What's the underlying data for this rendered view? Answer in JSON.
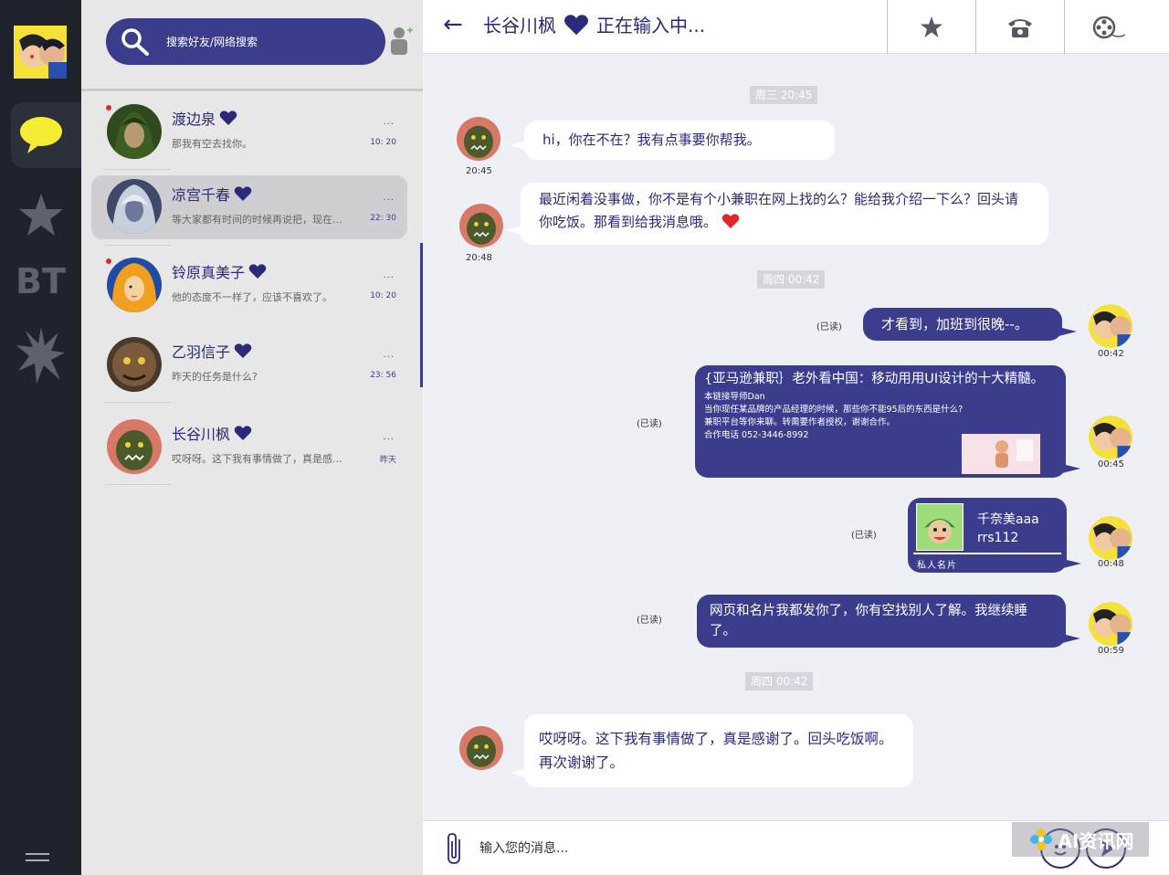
{
  "colors": {
    "accent": "#3b3d8c",
    "rail": "#1f232c",
    "panel": "#e8e7e7",
    "chat_bg": "#eef0f5",
    "unread": "#e22727",
    "heart_red": "#e02828"
  },
  "rail": {
    "items": [
      "chat-icon",
      "star-icon",
      "bt-icon",
      "burst-icon",
      "menu-icon"
    ],
    "bt_label": "BT"
  },
  "search": {
    "placeholder": "搜索好友/网络搜索"
  },
  "contacts": [
    {
      "name": "渡边泉",
      "preview": "那我有空去找你。",
      "time": "10: 20",
      "more": "···",
      "unread": true
    },
    {
      "name": "凉宫千春",
      "preview": "等大家都有时间的时候再说把，现在...",
      "time": "22: 30",
      "more": "···",
      "unread": false,
      "selected": true
    },
    {
      "name": "铃原真美子",
      "preview": "他的态度不一样了，应该不喜欢了。",
      "time": "10: 20",
      "more": "···",
      "unread": true
    },
    {
      "name": "乙羽信子",
      "preview": "昨天的任务是什么?",
      "time": "23: 56",
      "more": "···",
      "unread": false
    },
    {
      "name": "长谷川枫",
      "preview": "哎呀呀。这下我有事情做了，真是感...",
      "time": "昨天",
      "more": "···",
      "unread": false
    }
  ],
  "chat": {
    "back": "←",
    "name": "长谷川枫",
    "status": "正在输入中...",
    "stamps": [
      "周三 20:45",
      "周四 00:42",
      "周四 00:42"
    ],
    "messages": [
      {
        "from": "them",
        "text": "hi，你在不在？我有点事要你帮我。",
        "time": "20:45"
      },
      {
        "from": "them",
        "text": "最近闲着没事做，你不是有个小兼职在网上找的么？能给我介绍一下么？回头请你吃饭。那看到给我消息哦。",
        "time": "20:48"
      },
      {
        "from": "me",
        "text": "才看到，加班到很晚--。",
        "time": "00:42",
        "read": "(已读)"
      },
      {
        "from": "me",
        "type": "link",
        "title": "{亚马逊兼职｝老外看中国：移动用用UI设计的十大精髓。",
        "lines": [
          "本链接导师Dan",
          "当你现任某品牌的产品经理的时候，那些你不能95后的东西是什么?",
          "兼职平台等你来聊。转需要作者授权，谢谢合作。",
          "合作电话 052-3446-8992"
        ],
        "time": "00:45",
        "read": "(已读)"
      },
      {
        "from": "me",
        "type": "card",
        "card_name": "千奈美aaa",
        "card_id": "rrs112",
        "card_label": "私人名片",
        "time": "00:48",
        "read": "(已读)"
      },
      {
        "from": "me",
        "text": "网页和名片我都发你了，你有空找别人了解。我继续睡了。",
        "time": "00:59",
        "read": "(已读)"
      },
      {
        "from": "them",
        "text": "哎呀呀。这下我有事情做了，真是感谢了。回头吃饭啊。再次谢谢了。",
        "time": ""
      }
    ]
  },
  "header_buttons": [
    "star-icon",
    "phone-icon",
    "film-reel-icon"
  ],
  "composer": {
    "placeholder": "输入您的消息..."
  },
  "watermark": "AI资讯网"
}
